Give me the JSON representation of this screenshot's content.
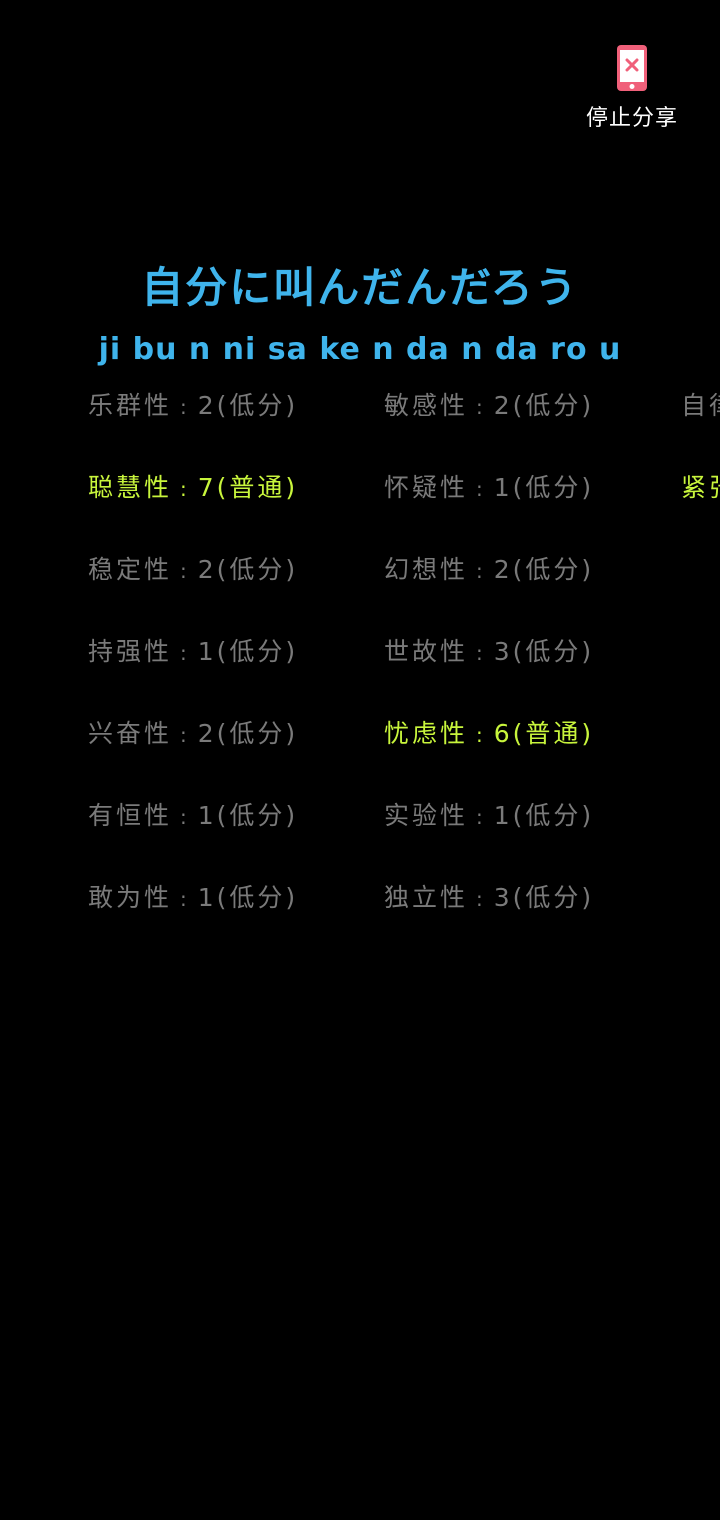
{
  "share": {
    "stop_label": "停止分享",
    "icon": "phone-stop-share-icon",
    "icon_color": "#f0607a"
  },
  "song": {
    "title": "自分に叫んだんだろう",
    "romaji": "ji bu n ni sa ke n da n da ro u",
    "color": "#3fb4ec"
  },
  "colors": {
    "normal": "#7a7a7a",
    "highlight": "#c8f53c"
  },
  "traits": {
    "col1": [
      {
        "name": "乐群性",
        "score": "2(低分)"
      },
      {
        "name": "聪慧性",
        "score": "7(普通)"
      },
      {
        "name": "稳定性",
        "score": "2(低分)"
      },
      {
        "name": "持强性",
        "score": "1(低分)"
      },
      {
        "name": "兴奋性",
        "score": "2(低分)"
      },
      {
        "name": "有恒性",
        "score": "1(低分)"
      },
      {
        "name": "敢为性",
        "score": "1(低分)"
      }
    ],
    "col2": [
      {
        "name": "敏感性",
        "score": "2(低分)"
      },
      {
        "name": "怀疑性",
        "score": "1(低分)"
      },
      {
        "name": "幻想性",
        "score": "2(低分)"
      },
      {
        "name": "世故性",
        "score": "3(低分)"
      },
      {
        "name": "忧虑性",
        "score": "6(普通)"
      },
      {
        "name": "实验性",
        "score": "1(低分)"
      },
      {
        "name": "独立性",
        "score": "3(低分)"
      }
    ],
    "col3": [
      {
        "name": "自律"
      },
      {
        "name": "紧张"
      }
    ]
  }
}
